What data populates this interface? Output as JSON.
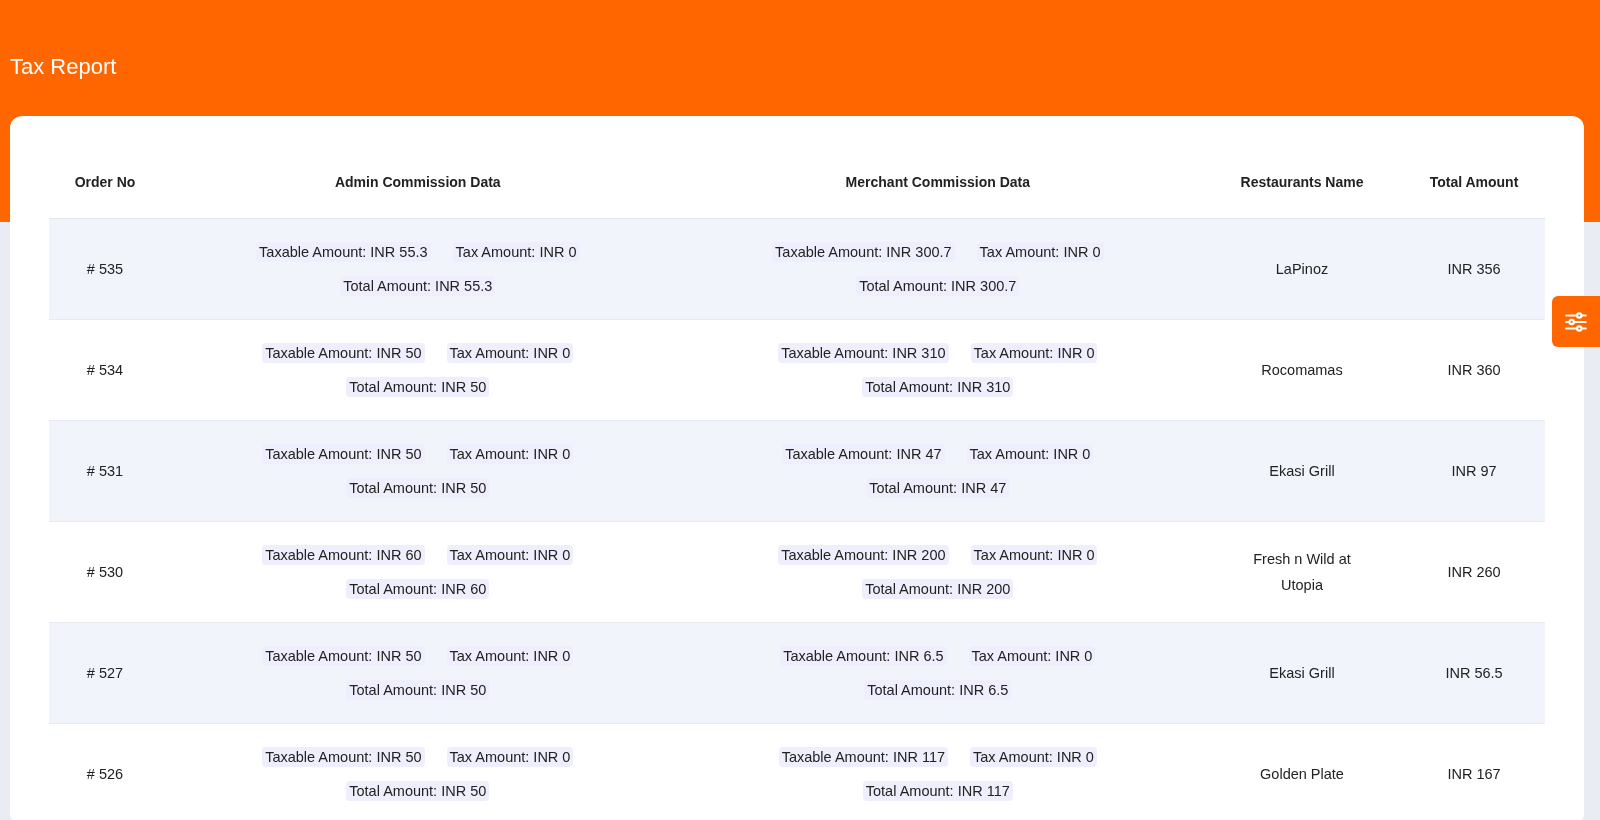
{
  "page": {
    "title": "Tax Report"
  },
  "table": {
    "columns": [
      "Order No",
      "Admin Commission Data",
      "Merchant Commission Data",
      "Restaurants Name",
      "Total Amount"
    ],
    "rows": [
      {
        "order_no": "# 535",
        "admin": [
          "Taxable Amount: INR 55.3",
          "Tax Amount: INR 0",
          "Total Amount: INR 55.3"
        ],
        "merchant": [
          "Taxable Amount: INR 300.7",
          "Tax Amount: INR 0",
          "Total Amount: INR 300.7"
        ],
        "restaurant": "LaPinoz",
        "total": "INR 356"
      },
      {
        "order_no": "# 534",
        "admin": [
          "Taxable Amount: INR 50",
          "Tax Amount: INR 0",
          "Total Amount: INR 50"
        ],
        "merchant": [
          "Taxable Amount: INR 310",
          "Tax Amount: INR 0",
          "Total Amount: INR 310"
        ],
        "restaurant": "Rocomamas",
        "total": "INR 360"
      },
      {
        "order_no": "# 531",
        "admin": [
          "Taxable Amount: INR 50",
          "Tax Amount: INR 0",
          "Total Amount: INR 50"
        ],
        "merchant": [
          "Taxable Amount: INR 47",
          "Tax Amount: INR 0",
          "Total Amount: INR 47"
        ],
        "restaurant": "Ekasi Grill",
        "total": "INR 97"
      },
      {
        "order_no": "# 530",
        "admin": [
          "Taxable Amount: INR 60",
          "Tax Amount: INR 0",
          "Total Amount: INR 60"
        ],
        "merchant": [
          "Taxable Amount: INR 200",
          "Tax Amount: INR 0",
          "Total Amount: INR 200"
        ],
        "restaurant": "Fresh n Wild at Utopia",
        "total": "INR 260"
      },
      {
        "order_no": "# 527",
        "admin": [
          "Taxable Amount: INR 50",
          "Tax Amount: INR 0",
          "Total Amount: INR 50"
        ],
        "merchant": [
          "Taxable Amount: INR 6.5",
          "Tax Amount: INR 0",
          "Total Amount: INR 6.5"
        ],
        "restaurant": "Ekasi Grill",
        "total": "INR 56.5"
      },
      {
        "order_no": "# 526",
        "admin": [
          "Taxable Amount: INR 50",
          "Tax Amount: INR 0",
          "Total Amount: INR 50"
        ],
        "merchant": [
          "Taxable Amount: INR 117",
          "Tax Amount: INR 0",
          "Total Amount: INR 117"
        ],
        "restaurant": "Golden Plate",
        "total": "INR 167"
      }
    ]
  }
}
